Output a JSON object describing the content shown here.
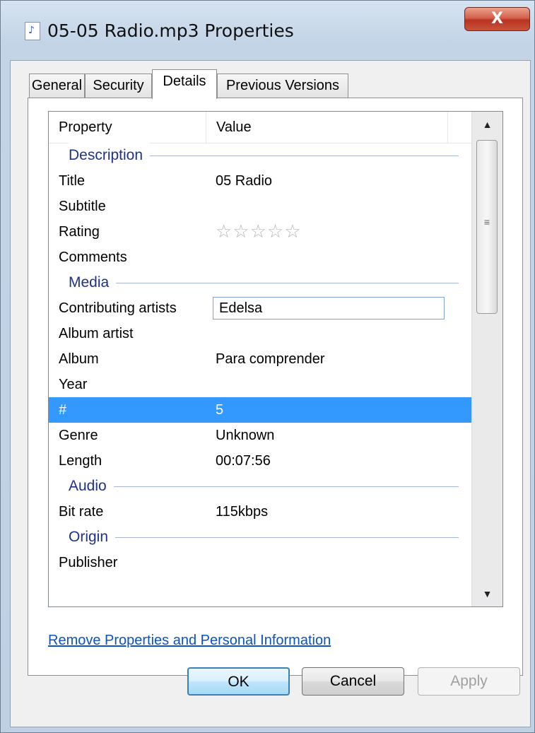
{
  "window": {
    "title": "05-05 Radio.mp3 Properties",
    "close_glyph": "X",
    "file_icon": "audio-file-icon"
  },
  "tabs": [
    {
      "label": "General",
      "active": false
    },
    {
      "label": "Security",
      "active": false
    },
    {
      "label": "Details",
      "active": true
    },
    {
      "label": "Previous Versions",
      "active": false
    }
  ],
  "list": {
    "columns": [
      "Property",
      "Value"
    ],
    "groups": {
      "description": "Description",
      "media": "Media",
      "audio": "Audio",
      "origin": "Origin"
    },
    "rows": {
      "title": {
        "name": "Title",
        "value": "05 Radio"
      },
      "subtitle": {
        "name": "Subtitle",
        "value": ""
      },
      "rating": {
        "name": "Rating",
        "value": "☆☆☆☆☆"
      },
      "comments": {
        "name": "Comments",
        "value": ""
      },
      "contributing_artists": {
        "name": "Contributing artists",
        "value": "Edelsa"
      },
      "album_artist": {
        "name": "Album artist",
        "value": ""
      },
      "album": {
        "name": "Album",
        "value": "Para comprender"
      },
      "year": {
        "name": "Year",
        "value": ""
      },
      "track": {
        "name": "#",
        "value": "5"
      },
      "genre": {
        "name": "Genre",
        "value": "Unknown"
      },
      "length": {
        "name": "Length",
        "value": "00:07:56"
      },
      "bit_rate": {
        "name": "Bit rate",
        "value": "115kbps"
      },
      "publisher": {
        "name": "Publisher",
        "value": ""
      }
    },
    "rating_stars": 0,
    "selected_row": "#"
  },
  "scrollbar": {
    "up_glyph": "▲",
    "down_glyph": "▼",
    "grip_glyph": "≡"
  },
  "links": {
    "remove_properties": "Remove Properties and Personal Information"
  },
  "buttons": {
    "ok": "OK",
    "cancel": "Cancel",
    "apply": "Apply"
  },
  "colors": {
    "selection": "#3399ff",
    "group_header": "#1e3287",
    "link": "#0b53c4",
    "close_button": "#c8543c"
  }
}
